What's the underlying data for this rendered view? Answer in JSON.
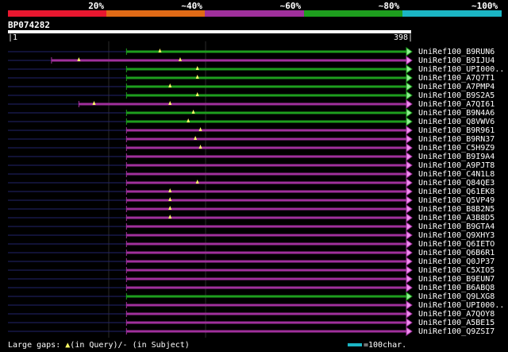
{
  "legend": {
    "labels": [
      "20%",
      "~40%",
      "~60%",
      "~80%",
      "~100%"
    ],
    "colors": [
      "#e8172f",
      "#e06a16",
      "#a0309c",
      "#1e9e1e",
      "#1bb5c4"
    ]
  },
  "query": {
    "id": "BP074282",
    "start_label": "|1",
    "end_label": "398|",
    "length": 398
  },
  "colors": {
    "purple": "#a0309c",
    "green": "#1e9e1e",
    "thin": "#22236b",
    "gap_marker": "#ffff66",
    "arrow_fill": "#f08cf0",
    "arrow_fill_green": "#90f090"
  },
  "hits": [
    {
      "name": "UniRef100_B9RUN6",
      "color": "green",
      "start": 117,
      "end": 398,
      "gaps": [
        150
      ]
    },
    {
      "name": "UniRef100_B9IJU4",
      "color": "purple",
      "start": 43,
      "end": 398,
      "gaps": [
        70,
        170
      ]
    },
    {
      "name": "UniRef100_UPI000..",
      "color": "green",
      "start": 117,
      "end": 398,
      "gaps": [
        187
      ]
    },
    {
      "name": "UniRef100_A7Q7T1",
      "color": "green",
      "start": 117,
      "end": 398,
      "gaps": [
        187
      ]
    },
    {
      "name": "UniRef100_A7PMP4",
      "color": "green",
      "start": 117,
      "end": 398,
      "gaps": [
        160
      ]
    },
    {
      "name": "UniRef100_B9S2A5",
      "color": "green",
      "start": 117,
      "end": 398,
      "gaps": [
        187
      ]
    },
    {
      "name": "UniRef100_A7QI61",
      "color": "purple",
      "start": 70,
      "end": 398,
      "gaps": [
        85,
        160
      ]
    },
    {
      "name": "UniRef100_B9N4A6",
      "color": "green",
      "start": 117,
      "end": 398,
      "gaps": [
        183
      ]
    },
    {
      "name": "UniRef100_Q8VWV6",
      "color": "green",
      "start": 117,
      "end": 398,
      "gaps": [
        178
      ]
    },
    {
      "name": "UniRef100_B9R961",
      "color": "purple",
      "start": 117,
      "end": 398,
      "gaps": [
        190
      ]
    },
    {
      "name": "UniRef100_B9RN37",
      "color": "purple",
      "start": 117,
      "end": 398,
      "gaps": [
        185
      ]
    },
    {
      "name": "UniRef100_C5H9Z9",
      "color": "purple",
      "start": 117,
      "end": 398,
      "gaps": [
        190
      ]
    },
    {
      "name": "UniRef100_B9I9A4",
      "color": "purple",
      "start": 117,
      "end": 398,
      "gaps": []
    },
    {
      "name": "UniRef100_A9PJT8",
      "color": "purple",
      "start": 117,
      "end": 398,
      "gaps": []
    },
    {
      "name": "UniRef100_C4N1L8",
      "color": "purple",
      "start": 117,
      "end": 398,
      "gaps": []
    },
    {
      "name": "UniRef100_Q84QE3",
      "color": "purple",
      "start": 117,
      "end": 398,
      "gaps": [
        187
      ]
    },
    {
      "name": "UniRef100_Q61EK8",
      "color": "purple",
      "start": 117,
      "end": 398,
      "gaps": [
        160
      ]
    },
    {
      "name": "UniRef100_Q5VP49",
      "color": "purple",
      "start": 117,
      "end": 398,
      "gaps": [
        160
      ]
    },
    {
      "name": "UniRef100_B8B2N5",
      "color": "purple",
      "start": 117,
      "end": 398,
      "gaps": [
        160
      ]
    },
    {
      "name": "UniRef100_A3B8D5",
      "color": "purple",
      "start": 117,
      "end": 398,
      "gaps": [
        160
      ]
    },
    {
      "name": "UniRef100_B9GTA4",
      "color": "purple",
      "start": 117,
      "end": 398,
      "gaps": []
    },
    {
      "name": "UniRef100_Q9XHY3",
      "color": "purple",
      "start": 117,
      "end": 398,
      "gaps": []
    },
    {
      "name": "UniRef100_Q6IETO",
      "color": "purple",
      "start": 117,
      "end": 398,
      "gaps": []
    },
    {
      "name": "UniRef100_Q6B6R1",
      "color": "purple",
      "start": 117,
      "end": 398,
      "gaps": []
    },
    {
      "name": "UniRef100_Q0JP37",
      "color": "purple",
      "start": 117,
      "end": 398,
      "gaps": []
    },
    {
      "name": "UniRef100_C5XIO5",
      "color": "purple",
      "start": 117,
      "end": 398,
      "gaps": []
    },
    {
      "name": "UniRef100_B9EUN7",
      "color": "purple",
      "start": 117,
      "end": 398,
      "gaps": []
    },
    {
      "name": "UniRef100_B6ABQ8",
      "color": "purple",
      "start": 117,
      "end": 398,
      "gaps": []
    },
    {
      "name": "UniRef100_Q9LXG8",
      "color": "green",
      "start": 117,
      "end": 398,
      "gaps": []
    },
    {
      "name": "UniRef100_UPI000..",
      "color": "purple",
      "start": 117,
      "end": 398,
      "gaps": []
    },
    {
      "name": "UniRef100_A7QOY8",
      "color": "purple",
      "start": 117,
      "end": 398,
      "gaps": []
    },
    {
      "name": "UniRef100_A5BE15",
      "color": "purple",
      "start": 117,
      "end": 398,
      "gaps": []
    },
    {
      "name": "UniRef100_Q9ZSI7",
      "color": "purple",
      "start": 117,
      "end": 398,
      "gaps": []
    }
  ],
  "footer": {
    "gaps_prefix": "Large gaps:",
    "gaps_query_glyph": "▲",
    "gaps_text": "(in Query)/- (in Subject)",
    "scale_text": "=100char."
  }
}
